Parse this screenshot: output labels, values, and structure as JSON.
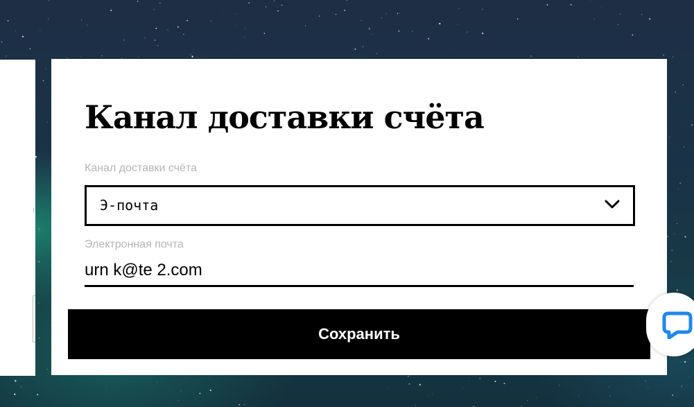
{
  "card": {
    "title": "Канал доставки счёта"
  },
  "delivery_channel": {
    "label": "Канал доставки счёта",
    "selected_value": "Э-почта",
    "icon": "chevron-down-icon"
  },
  "email": {
    "label": "Электронная почта",
    "value": "urn         k@te    2.com"
  },
  "actions": {
    "save_label": "Сохранить"
  },
  "chat_widget": {
    "icon": "chat-bubble-icon",
    "accent_color": "#1e87f0"
  },
  "colors": {
    "button_bg": "#000000",
    "label_gray": "#b4b4b4"
  }
}
